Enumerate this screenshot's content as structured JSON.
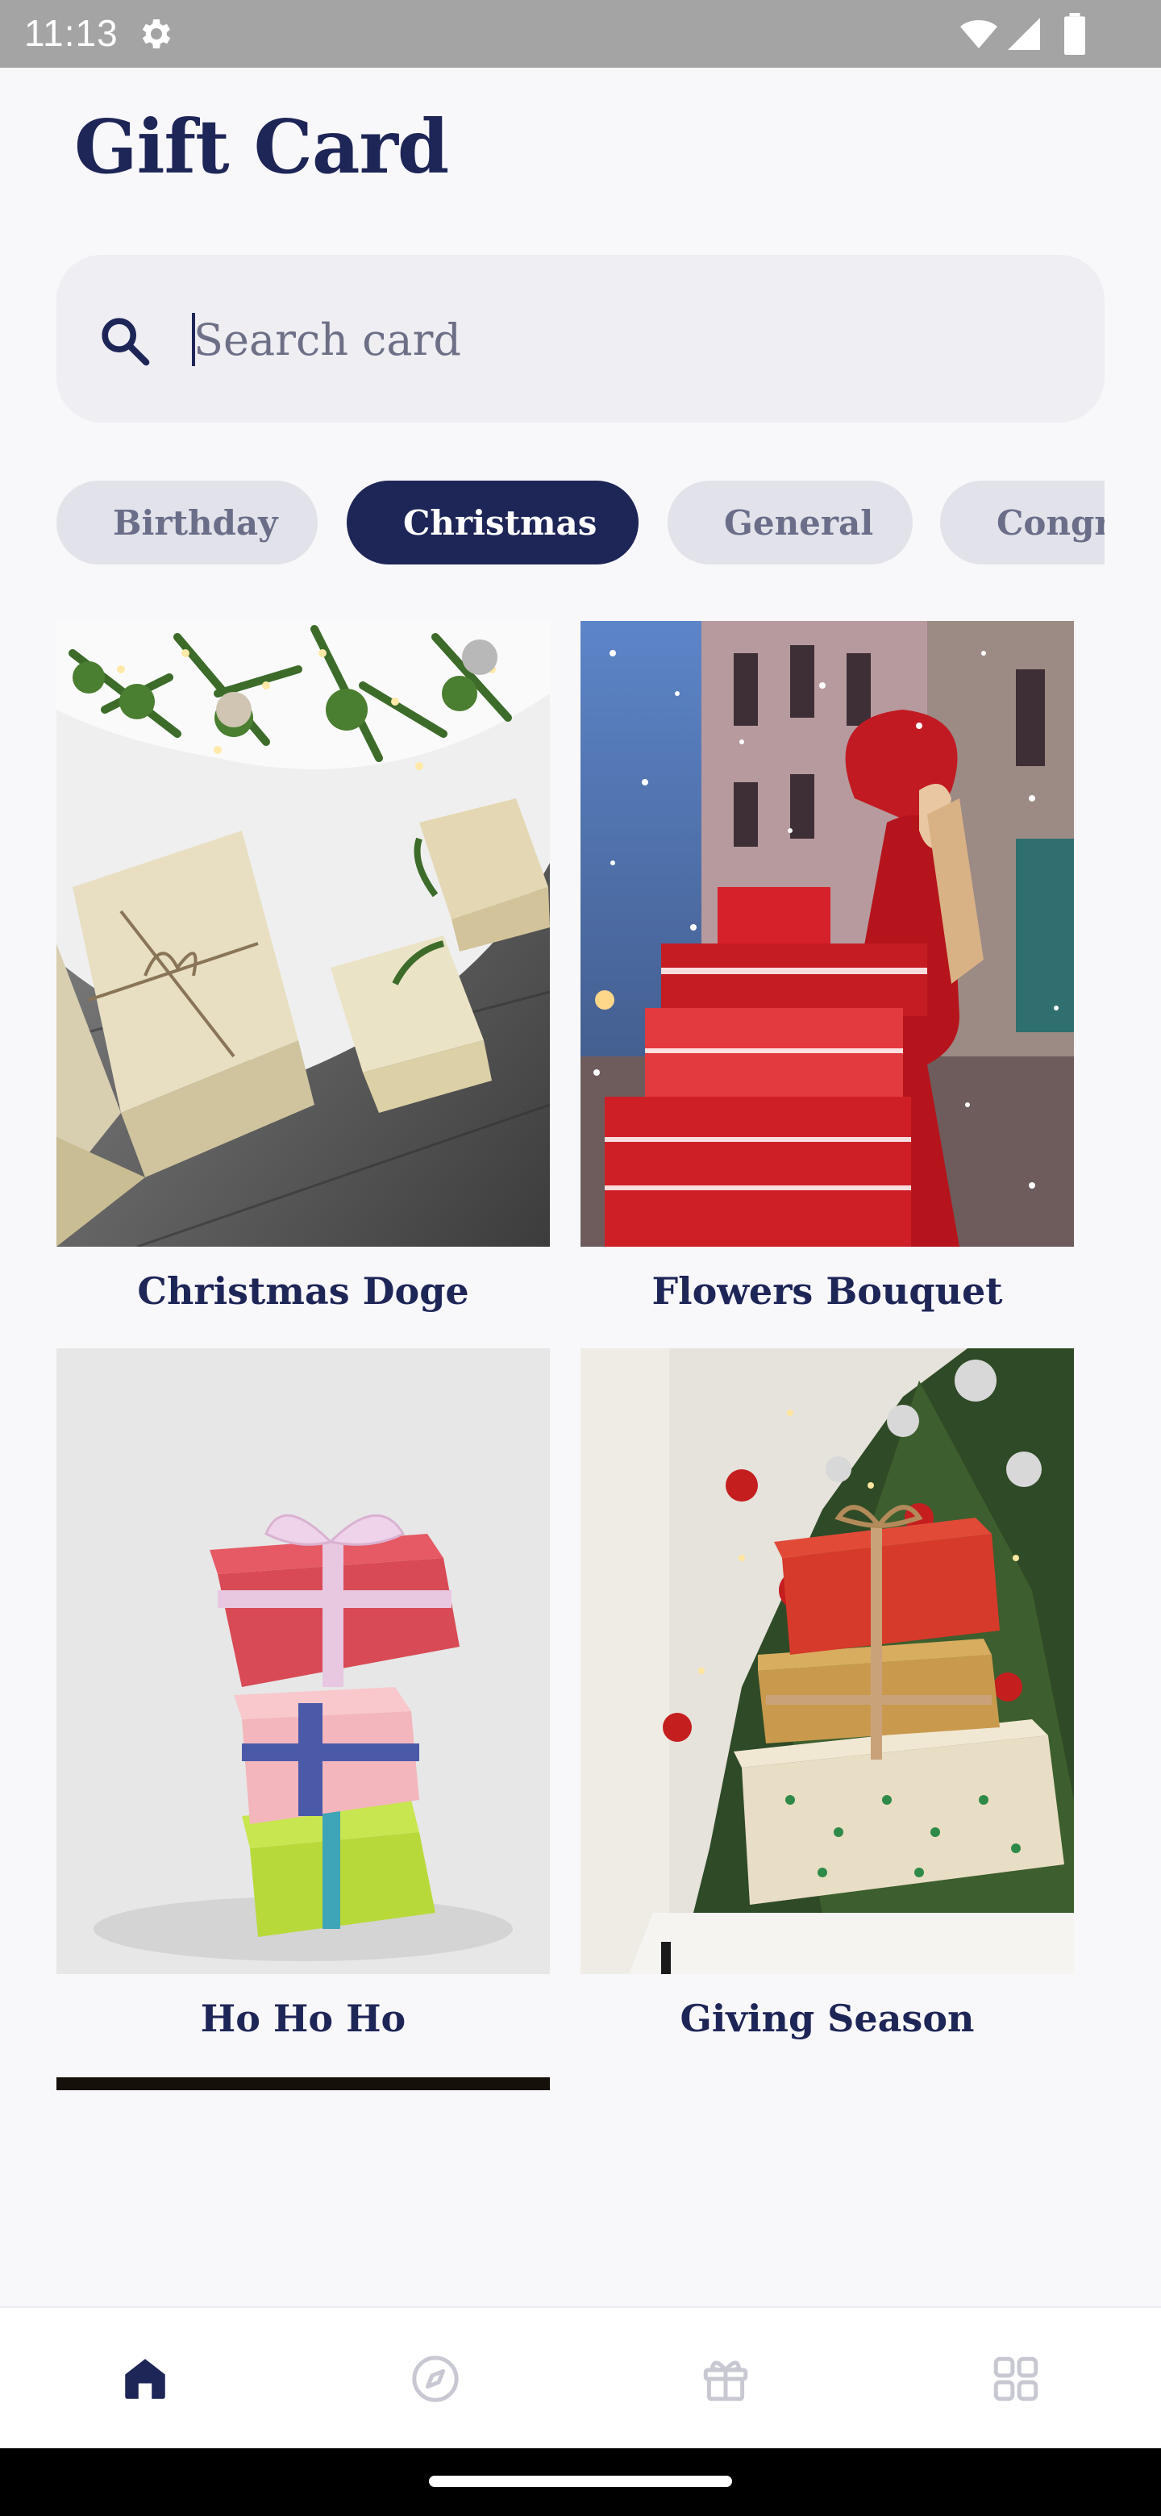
{
  "status_bar": {
    "time": "11:13",
    "icons": [
      "gear-icon",
      "wifi-icon",
      "signal-icon",
      "battery-icon"
    ]
  },
  "header": {
    "title": "Gift Card"
  },
  "search": {
    "placeholder": "Search card",
    "value": ""
  },
  "categories": [
    {
      "label": "Birthday",
      "selected": false
    },
    {
      "label": "Christmas",
      "selected": true
    },
    {
      "label": "General",
      "selected": false
    },
    {
      "label": "Congra",
      "selected": false
    }
  ],
  "cards": [
    {
      "title": "Christmas Doge",
      "image": "gifts-under-tree"
    },
    {
      "title": "Flowers Bouquet",
      "image": "woman-carrying-red-gifts-in-snow"
    },
    {
      "title": "Ho Ho Ho",
      "image": "stacked-colorful-gifts"
    },
    {
      "title": "Giving Season",
      "image": "gifts-by-christmas-tree"
    }
  ],
  "bottom_nav": [
    {
      "name": "home",
      "icon": "home-icon",
      "active": true
    },
    {
      "name": "explore",
      "icon": "compass-icon",
      "active": false
    },
    {
      "name": "gifts",
      "icon": "gift-icon",
      "active": false
    },
    {
      "name": "more",
      "icon": "grid-icon",
      "active": false
    }
  ],
  "colors": {
    "primary": "#1e2557",
    "background": "#f8f8fa",
    "chip_inactive": "#e2e3ea",
    "search_bg": "#eeeef3"
  }
}
